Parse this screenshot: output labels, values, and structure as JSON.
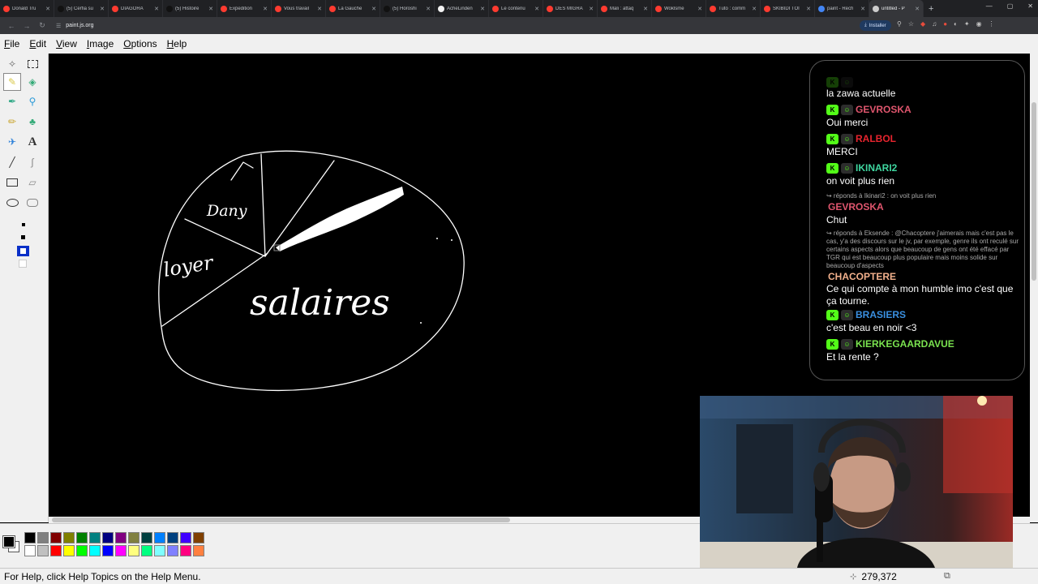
{
  "browser": {
    "tabs": [
      {
        "title": "Donald Tru",
        "favicon_color": "#ff3b30"
      },
      {
        "title": "(5) Cerfia su",
        "favicon_color": "#111111"
      },
      {
        "title": "DIAGORA",
        "favicon_color": "#ff3b30"
      },
      {
        "title": "(5) Histoire",
        "favicon_color": "#111111"
      },
      {
        "title": "Expedition",
        "favicon_color": "#ff3b30"
      },
      {
        "title": "Vous travail",
        "favicon_color": "#ff3b30"
      },
      {
        "title": "La Gauche",
        "favicon_color": "#ff3b30"
      },
      {
        "title": "(5) Horoshi",
        "favicon_color": "#111111"
      },
      {
        "title": "AcheLinden",
        "favicon_color": "#f2f2f2"
      },
      {
        "title": "Le contenu",
        "favicon_color": "#ff3b30"
      },
      {
        "title": "DES MIGRA",
        "favicon_color": "#ff3b30"
      },
      {
        "title": "Mali : attaq",
        "favicon_color": "#ff3b30"
      },
      {
        "title": "Woklsme",
        "favicon_color": "#ff3b30"
      },
      {
        "title": "Tuto : comm",
        "favicon_color": "#ff3b30"
      },
      {
        "title": "SKIBIDI TOI",
        "favicon_color": "#ff3b30"
      },
      {
        "title": "paint - Rech",
        "favicon_color": "#4285f4"
      },
      {
        "title": "untitled - P",
        "favicon_color": "#cccccc",
        "active": true
      }
    ],
    "url": "paint.js.org",
    "install_label": "Installer"
  },
  "app": {
    "menus": [
      {
        "label": "File",
        "underline": "F",
        "rest": "ile"
      },
      {
        "label": "Edit",
        "underline": "E",
        "rest": "dit"
      },
      {
        "label": "View",
        "underline": "V",
        "rest": "iew"
      },
      {
        "label": "Image",
        "underline": "I",
        "rest": "mage"
      },
      {
        "label": "Options",
        "underline": "O",
        "rest": "ptions"
      },
      {
        "label": "Help",
        "underline": "H",
        "rest": "elp"
      }
    ],
    "status_text": "For Help, click Help Topics on the Help Menu.",
    "cursor_coords": "279,372",
    "palette": [
      "#000000",
      "#808080",
      "#800000",
      "#808000",
      "#008000",
      "#008080",
      "#000080",
      "#800080",
      "#808040",
      "#004040",
      "#0080ff",
      "#004080",
      "#4000ff",
      "#804000",
      "#ffffff",
      "#c0c0c0",
      "#ff0000",
      "#ffff00",
      "#00ff00",
      "#00ffff",
      "#0000ff",
      "#ff00ff",
      "#ffff80",
      "#00ff80",
      "#80ffff",
      "#8080ff",
      "#ff0080",
      "#ff8040"
    ],
    "canvas_labels": {
      "dany": "Dany",
      "loyer": "loyer",
      "salaires": "salaires"
    }
  },
  "chat": {
    "top_text": "la zawa actuelle",
    "messages": [
      {
        "user": "GEVROSKA",
        "color": "#e0566e",
        "text": "Oui merci"
      },
      {
        "user": "RALBOL",
        "color": "#e8242e",
        "text": "MERCI"
      },
      {
        "user": "IKINARI2",
        "color": "#3fd7a0",
        "text": "on voit plus rien"
      },
      {
        "user": "GEVROSKA",
        "color": "#e0566e",
        "reply": "↪ réponds à Ikinari2 : on voit plus rien",
        "text": "Chut"
      },
      {
        "user": "CHACOPTERE",
        "color": "#f3b18c",
        "reply": "↪ réponds à Eksende : @Chacoptere j'aimerais mais c'est pas le cas, y'a des discours sur le jv, par exemple, genre ils ont reculé sur certains aspects alors que beaucoup de gens ont été effacé par TGR qui est beaucoup plus populaire mais moins solide sur beaucoup d'aspects",
        "text": "Ce qui compte à mon humble imo c'est que ça tourne."
      },
      {
        "user": "BRASIERS",
        "color": "#3a8fe0",
        "text": "c'est beau en noir <3"
      },
      {
        "user": "KIERKEGAARDAVUE",
        "color": "#7ae34f",
        "text": "Et la rente ?"
      }
    ]
  }
}
